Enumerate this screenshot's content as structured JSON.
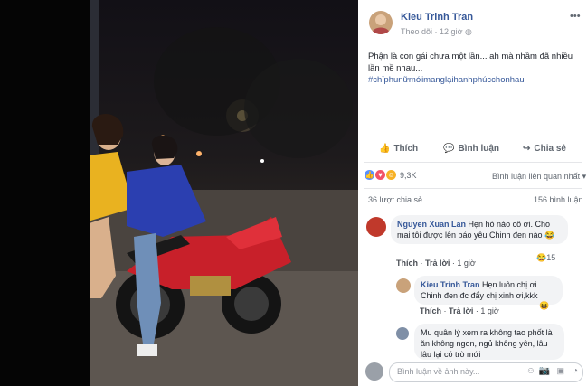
{
  "author": {
    "name": "Kieu Trinh Tran",
    "follow_label": "Theo dõi",
    "time": "12 giờ"
  },
  "post": {
    "text": "Phận là con gái chưa một lần... ah mà nhầm đã nhiều lần mề nhau...",
    "hashtag": "#chỉphunữmớimanglạihanhphúcchonhau"
  },
  "actions": {
    "like": "Thích",
    "comment": "Bình luận",
    "share": "Chia sẻ"
  },
  "reactions": {
    "count": "9,3K",
    "sort_label": "Bình luận liên quan nhất ▾"
  },
  "stats": {
    "shares": "36 lượt chia sẻ",
    "comments": "156 bình luận"
  },
  "comments": [
    {
      "name": "Nguyen Xuan Lan",
      "text": "Hẹn hò nào cô ơi. Cho mai tôi được lên báo yêu Chinh đen nào 😂",
      "like": "Thích",
      "reply": "Trả lời",
      "time": "1 giờ",
      "reaction_count": "15"
    },
    {
      "name": "Kieu Trinh Tran",
      "text": "Hẹn luôn chị ơi. Chinh đen đc đẩy chị xinh ơi,kkk",
      "like": "Thích",
      "reply": "Trả lời",
      "time": "1 giờ"
    },
    {
      "name": "",
      "text": "Mu quân lý xem ra không tao phốt là ăn không ngon, ngủ không yên, lâu lâu lại có trò mới",
      "like": "",
      "reply": "",
      "time": ""
    }
  ],
  "input": {
    "placeholder": "Bình luận về ảnh này..."
  },
  "colors": {
    "link": "#365899",
    "meta": "#90949c",
    "panel_bg": "#ffffff"
  }
}
